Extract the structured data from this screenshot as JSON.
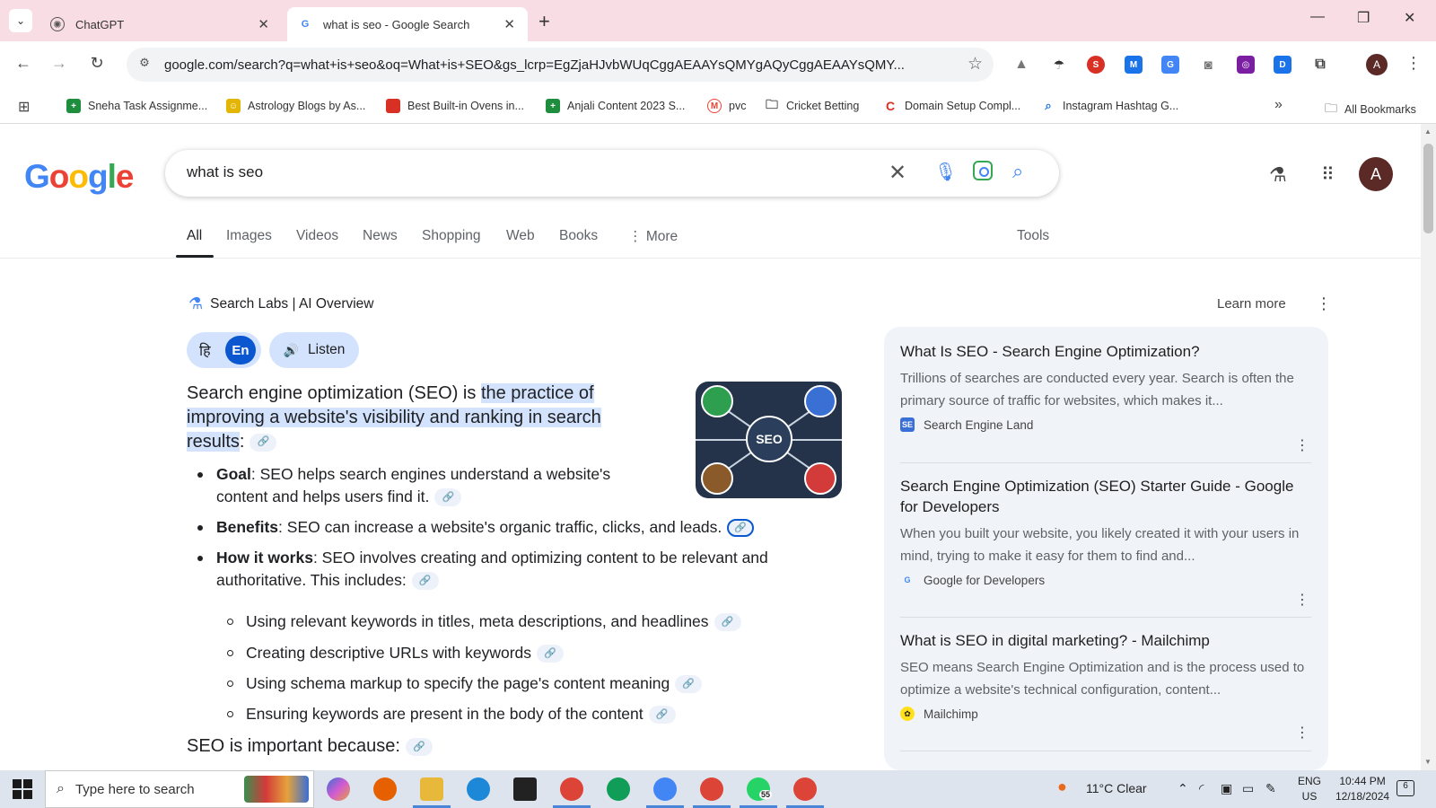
{
  "browser": {
    "tabs": [
      {
        "title": "ChatGPT",
        "icon": "openai-icon"
      },
      {
        "title": "what is seo - Google Search",
        "icon": "google-g-icon",
        "active": true
      }
    ],
    "url": "google.com/search?q=what+is+seo&oq=What+is+SEO&gs_lcrp=EgZjaHJvbWUqCggAEAAYsQMYgAQyCggAEAAYsQMY...",
    "profile_initial": "A",
    "bookmarks": [
      {
        "label": "Sneha Task Assignme...",
        "icon_color": "#1e8e3e",
        "icon": "+"
      },
      {
        "label": "Astrology Blogs by As...",
        "icon_color": "#e3b505",
        "icon": "☺"
      },
      {
        "label": "Best Built-in Ovens in...",
        "icon_color": "#d93025",
        "icon": ""
      },
      {
        "label": "Anjali Content 2023 S...",
        "icon_color": "#1e8e3e",
        "icon": "+"
      },
      {
        "label": "pvc",
        "icon_color": "#ea4335",
        "icon": "M"
      },
      {
        "label": "Cricket Betting",
        "icon_color": "#ffffff",
        "icon": "🗀"
      },
      {
        "label": "Domain Setup Compl...",
        "icon_color": "#d93025",
        "icon": "C"
      },
      {
        "label": "Instagram Hashtag G...",
        "icon_color": "#ffffff",
        "icon": "🔍"
      }
    ],
    "all_bookmarks": "All Bookmarks"
  },
  "google": {
    "logo": "Google",
    "query": "what is seo",
    "avatar_initial": "A",
    "tabs": [
      "All",
      "Images",
      "Videos",
      "News",
      "Shopping",
      "Web",
      "Books",
      "More"
    ],
    "tools": "Tools"
  },
  "ai_overview": {
    "header": "Search Labs | AI Overview",
    "learn_more": "Learn more",
    "lang_hi": "हि",
    "lang_en": "En",
    "listen": "Listen",
    "intro_prefix": "Search engine optimization (SEO) is ",
    "intro_highlight": "the practice of improving a website's visibility and ranking in search results",
    "intro_suffix": ":",
    "image_label": "SEO",
    "bullets": [
      {
        "bold": "Goal",
        "text": ": SEO helps search engines understand a website's content and helps users find it."
      },
      {
        "bold": "Benefits",
        "text": ": SEO can increase a website's organic traffic, clicks, and leads."
      },
      {
        "bold": "How it works",
        "text": ": SEO involves creating and optimizing content to be relevant and authoritative. This includes:"
      }
    ],
    "sub_bullets": [
      "Using relevant keywords in titles, meta descriptions, and headlines",
      "Creating descriptive URLs with keywords",
      "Using schema markup to specify the page's content meaning",
      "Ensuring keywords are present in the body of the content"
    ],
    "important": "SEO is important because:"
  },
  "sources": [
    {
      "title": "What Is SEO - Search Engine Optimization?",
      "snippet": "Trillions of searches are conducted every year. Search is often the primary source of traffic for websites, which makes it...",
      "site": "Search Engine Land",
      "fav_color": "#3b6fd8"
    },
    {
      "title": "Search Engine Optimization (SEO) Starter Guide - Google for Developers",
      "snippet": "When you built your website, you likely created it with your users in mind, trying to make it easy for them to find and...",
      "site": "Google for Developers",
      "fav_color": "#4285f4"
    },
    {
      "title": "What is SEO in digital marketing? - Mailchimp",
      "snippet": "SEO means Search Engine Optimization and is the process used to optimize a website's technical configuration, content...",
      "site": "Mailchimp",
      "fav_color": "#ffe01b"
    }
  ],
  "taskbar": {
    "search_placeholder": "Type here to search",
    "weather": "11°C  Clear",
    "lang": "ENG",
    "region": "US",
    "time": "10:44 PM",
    "date": "12/18/2024",
    "whatsapp_badge": "55",
    "notifications": "6"
  }
}
